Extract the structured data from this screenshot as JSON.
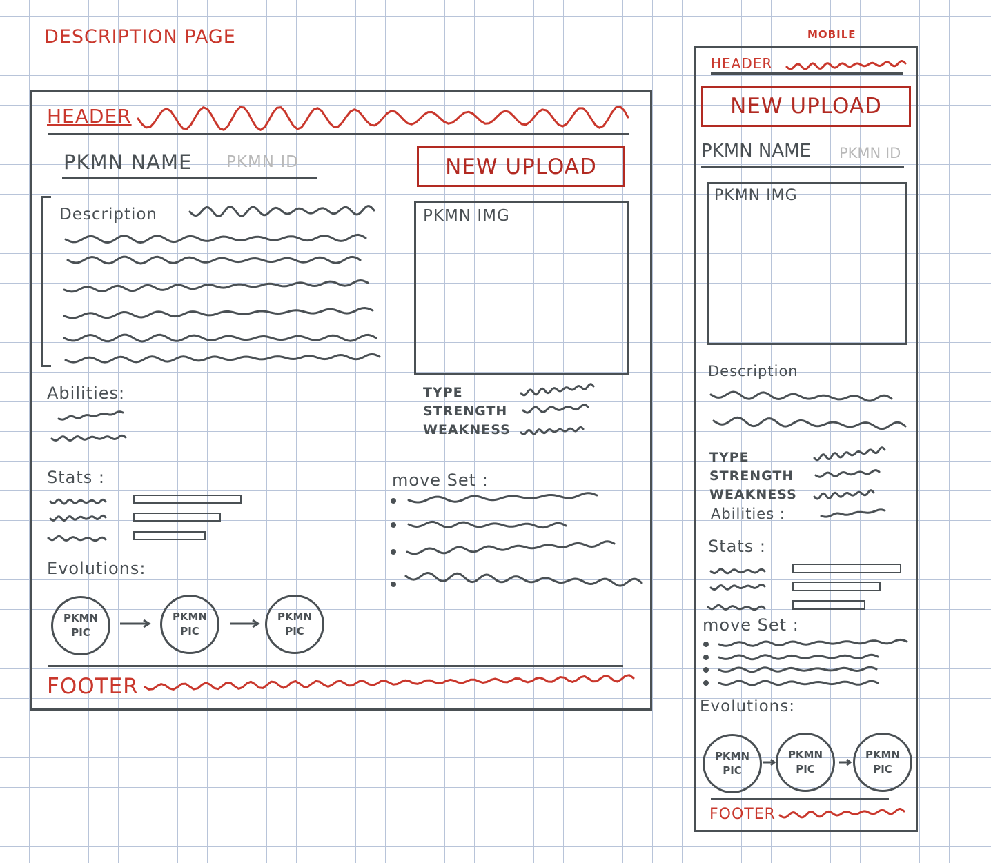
{
  "page_title": "DESCRIPTION PAGE",
  "mobile_label": "MOBILE",
  "desktop": {
    "header": "HEADER",
    "name": "PKMN NAME",
    "id": "PKMN ID",
    "upload": "NEW UPLOAD",
    "description": "Description",
    "image": "PKMN IMG",
    "type": "TYPE",
    "strength": "STRENGTH",
    "weakness": "WEAKNESS",
    "abilities": "Abilities:",
    "stats": "Stats :",
    "move_set": "move Set :",
    "evolutions": "Evolutions:",
    "pic_line1": "PKMN",
    "pic_line2": "PIC",
    "footer": "FOOTER"
  },
  "mobile": {
    "header": "HEADER",
    "upload": "NEW UPLOAD",
    "name": "PKMN NAME",
    "id": "PKMN ID",
    "image": "PKMN IMG",
    "description": "Description",
    "type": "TYPE",
    "strength": "STRENGTH",
    "weakness": "WEAKNESS",
    "abilities": "Abilities :",
    "stats": "Stats :",
    "move_set": "move Set :",
    "evolutions": "Evolutions:",
    "pic_line1": "PKMN",
    "pic_line2": "PIC",
    "footer": "FOOTER"
  },
  "colors": {
    "red": "#c9372c",
    "dark_red": "#b22a22",
    "ink": "#4a5054",
    "grid": "#b8c4d9"
  }
}
